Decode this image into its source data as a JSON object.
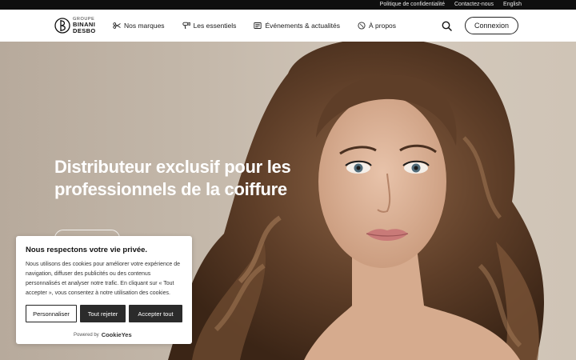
{
  "topbar": {
    "privacy": "Politique de confidentialité",
    "contact": "Contactez-nous",
    "language": "English"
  },
  "logo": {
    "line1": "GROUPE",
    "line2": "BINANI",
    "line3": "DESBO"
  },
  "nav": {
    "items": [
      {
        "label": "Nos marques",
        "icon": "scissors-icon"
      },
      {
        "label": "Les essentiels",
        "icon": "hairdryer-icon"
      },
      {
        "label": "Événements & actualités",
        "icon": "newspaper-icon"
      },
      {
        "label": "À propos",
        "icon": "globe-icon"
      }
    ]
  },
  "header": {
    "search_icon": "search-icon",
    "login_label": "Connexion"
  },
  "hero": {
    "title_line1": "Distributeur exclusif pour les",
    "title_line2": "professionnels de la coiffure"
  },
  "cookie": {
    "title": "Nous respectons votre vie privée.",
    "text": "Nous utilisons des cookies pour améliorer votre expérience de navigation, diffuser des publicités ou des contenus personnalisés et analyser notre trafic. En cliquant sur « Tout accepter », vous consentez à notre utilisation des cookies.",
    "customize": "Personnaliser",
    "reject": "Tout rejeter",
    "accept": "Accepter tout",
    "powered_by": "Powered by",
    "brand": "CookieYes"
  },
  "colors": {
    "topbar": "#0f0f0f",
    "button_dark": "#2b2b2b",
    "hero_bg": "#c4b8aa"
  }
}
